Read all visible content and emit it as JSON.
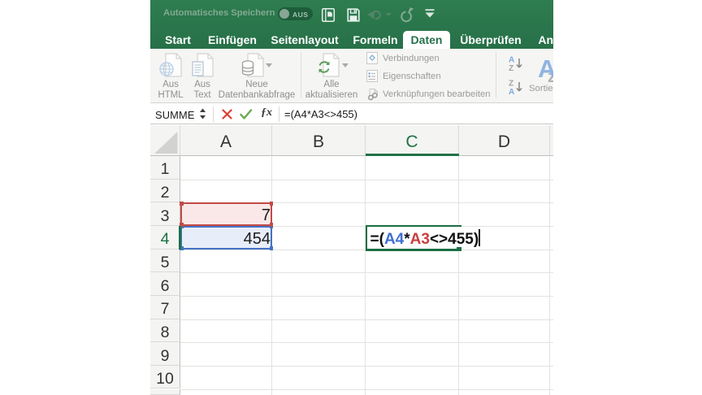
{
  "titlebar": {
    "autosave_label": "Automatisches Speichern",
    "autosave_state": "AUS"
  },
  "theme": {
    "excel_green_dark": "#26704a",
    "excel_green_light": "#2f8153",
    "ribbon_background": "#f5f5f3",
    "formula_reference_blue": "#3f6fd1",
    "formula_reference_red": "#c8403c"
  },
  "tabs": {
    "items": [
      {
        "label": "Start"
      },
      {
        "label": "Einfügen"
      },
      {
        "label": "Seitenlayout"
      },
      {
        "label": "Formeln"
      },
      {
        "label": "Daten"
      },
      {
        "label": "Überprüfen"
      },
      {
        "label": "Ansicht"
      }
    ],
    "active": "Daten"
  },
  "ribbon": {
    "from_html": "Aus\nHTML",
    "from_html_l1": "Aus",
    "from_html_l2": "HTML",
    "from_text_l1": "Aus",
    "from_text_l2": "Text",
    "new_db_l1": "Neue",
    "new_db_l2": "Datenbankabfrage",
    "refresh_l1": "Alle",
    "refresh_l2": "aktualisieren",
    "connections": "Verbindungen",
    "properties": "Eigenschaften",
    "edit_links": "Verknüpfungen bearbeiten",
    "sort_label": "Sortieren"
  },
  "formula_bar": {
    "name_box": "SUMME",
    "formula": "=(A4*A3<>455)"
  },
  "grid": {
    "columns": [
      "A",
      "B",
      "C",
      "D"
    ],
    "rows": [
      "1",
      "2",
      "3",
      "4",
      "5",
      "6",
      "7",
      "8",
      "9",
      "10"
    ],
    "selected_column": "C",
    "selected_row": "4",
    "cells": [
      {
        "ref": "A3",
        "value": "7",
        "fill": "#f9e8e7",
        "border": "#c24a46"
      },
      {
        "ref": "A4",
        "value": "454",
        "fill": "#e8eef9",
        "border": "#4472c4"
      }
    ],
    "edit_cell": {
      "ref": "C4",
      "tokens": [
        {
          "text": "=(",
          "color": "#111111"
        },
        {
          "text": "A4",
          "color": "#3f6fd1"
        },
        {
          "text": "*",
          "color": "#111111"
        },
        {
          "text": "A3",
          "color": "#c8403c"
        },
        {
          "text": "<>455)",
          "color": "#111111"
        }
      ],
      "border_color": "#1b6e42"
    },
    "colors": {
      "selection_green": "#1f7145"
    }
  }
}
